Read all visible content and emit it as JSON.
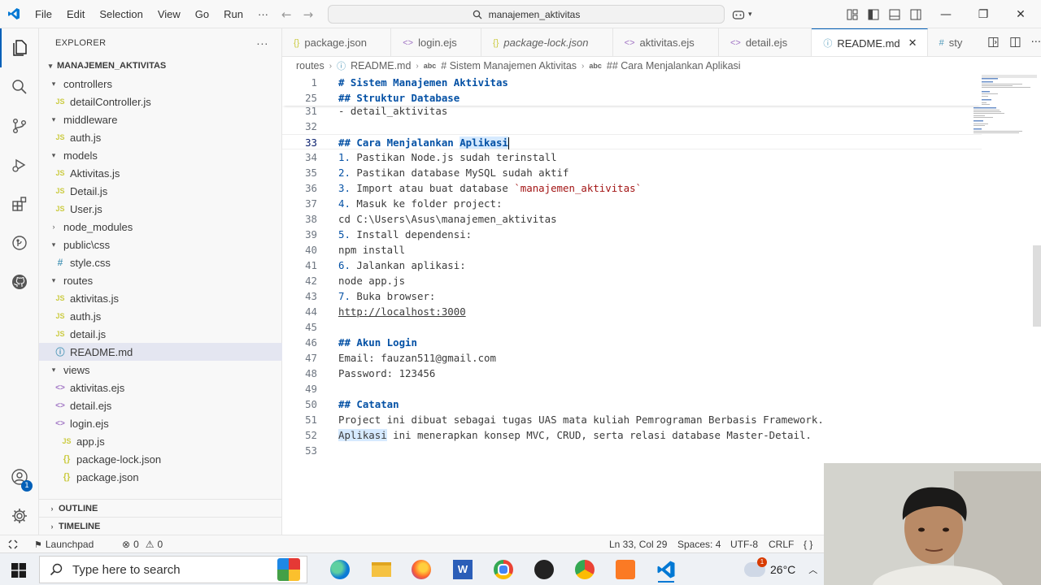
{
  "titlebar": {
    "menu": [
      "File",
      "Edit",
      "Selection",
      "View",
      "Go",
      "Run",
      "···"
    ],
    "search_text": "manajemen_aktivitas"
  },
  "explorer": {
    "header": "EXPLORER",
    "root": "MANAJEMEN_AKTIVITAS",
    "rows": [
      {
        "label": "controllers",
        "kind": "folder",
        "open": true,
        "depth": 1
      },
      {
        "label": "detailController.js",
        "kind": "js",
        "depth": 2
      },
      {
        "label": "middleware",
        "kind": "folder",
        "open": true,
        "depth": 1
      },
      {
        "label": "auth.js",
        "kind": "js",
        "depth": 2
      },
      {
        "label": "models",
        "kind": "folder",
        "open": true,
        "depth": 1
      },
      {
        "label": "Aktivitas.js",
        "kind": "js",
        "depth": 2
      },
      {
        "label": "Detail.js",
        "kind": "js",
        "depth": 2
      },
      {
        "label": "User.js",
        "kind": "js",
        "depth": 2
      },
      {
        "label": "node_modules",
        "kind": "folder",
        "open": false,
        "depth": 1
      },
      {
        "label": "public\\css",
        "kind": "folder",
        "open": true,
        "depth": 1
      },
      {
        "label": "style.css",
        "kind": "css",
        "depth": 2
      },
      {
        "label": "routes",
        "kind": "folder",
        "open": true,
        "depth": 1
      },
      {
        "label": "aktivitas.js",
        "kind": "js",
        "depth": 2
      },
      {
        "label": "auth.js",
        "kind": "js",
        "depth": 2
      },
      {
        "label": "detail.js",
        "kind": "js",
        "depth": 2
      },
      {
        "label": "README.md",
        "kind": "md",
        "depth": 2,
        "selected": true
      },
      {
        "label": "views",
        "kind": "folder",
        "open": true,
        "depth": 1
      },
      {
        "label": "aktivitas.ejs",
        "kind": "ejs",
        "depth": 2
      },
      {
        "label": "detail.ejs",
        "kind": "ejs",
        "depth": 2
      },
      {
        "label": "login.ejs",
        "kind": "ejs",
        "depth": 2
      },
      {
        "label": "app.js",
        "kind": "js",
        "depth": 1
      },
      {
        "label": "package-lock.json",
        "kind": "json",
        "depth": 1
      },
      {
        "label": "package.json",
        "kind": "json",
        "depth": 1
      }
    ],
    "outline": "OUTLINE",
    "timeline": "TIMELINE"
  },
  "tabs": [
    {
      "label": "package.json",
      "icon": "{}"
    },
    {
      "label": "login.ejs",
      "icon": "<>"
    },
    {
      "label": "package-lock.json",
      "icon": "{}",
      "italic": true
    },
    {
      "label": "aktivitas.ejs",
      "icon": "<>"
    },
    {
      "label": "detail.ejs",
      "icon": "<>"
    },
    {
      "label": "README.md",
      "icon": "ⓘ",
      "active": true
    },
    {
      "label": "sty",
      "icon": "#"
    }
  ],
  "breadcrumb": [
    "routes",
    "README.md",
    "# Sistem Manajemen Aktivitas",
    "## Cara Menjalankan Aplikasi"
  ],
  "editor": {
    "sticky": [
      {
        "n": "1",
        "text": "# Sistem Manajemen Aktivitas"
      },
      {
        "n": "25",
        "text": "## Struktur Database"
      }
    ],
    "lines": [
      {
        "n": "31",
        "text": "- detail_aktivitas"
      },
      {
        "n": "32",
        "text": ""
      },
      {
        "n": "33",
        "pre": "## Cara Menjalankan ",
        "hl": "Aplikasi",
        "heading": true,
        "current": true
      },
      {
        "n": "34",
        "num": "1.",
        "text": " Pastikan Node.js sudah terinstall"
      },
      {
        "n": "35",
        "num": "2.",
        "text": " Pastikan database MySQL sudah aktif"
      },
      {
        "n": "36",
        "num": "3.",
        "text": " Import atau buat database ",
        "code": "`manajemen_aktivitas`"
      },
      {
        "n": "37",
        "num": "4.",
        "text": " Masuk ke folder project:"
      },
      {
        "n": "38",
        "text": "cd C:\\Users\\Asus\\manajemen_aktivitas"
      },
      {
        "n": "39",
        "num": "5.",
        "text": " Install dependensi:"
      },
      {
        "n": "40",
        "text": "npm install"
      },
      {
        "n": "41",
        "num": "6.",
        "text": " Jalankan aplikasi:"
      },
      {
        "n": "42",
        "text": "node app.js"
      },
      {
        "n": "43",
        "num": "7.",
        "text": " Buka browser:"
      },
      {
        "n": "44",
        "link": "http://localhost:3000"
      },
      {
        "n": "45",
        "text": ""
      },
      {
        "n": "46",
        "text": "## Akun Login",
        "heading": true
      },
      {
        "n": "47",
        "text": "Email: fauzan511@gmail.com"
      },
      {
        "n": "48",
        "text": "Password: 123456"
      },
      {
        "n": "49",
        "text": ""
      },
      {
        "n": "50",
        "text": "## Catatan",
        "heading": true
      },
      {
        "n": "51",
        "text": "Project ini dibuat sebagai tugas UAS mata kuliah Pemrograman Berbasis Framework."
      },
      {
        "n": "52",
        "hl": "Aplikasi",
        "text": " ini menerapkan konsep MVC, CRUD, serta relasi database Master-Detail."
      },
      {
        "n": "53",
        "text": ""
      }
    ]
  },
  "statusbar": {
    "launchpad": "Launchpad",
    "errors": "0",
    "warnings": "0",
    "position": "Ln 33, Col 29",
    "spaces": "Spaces: 4",
    "encoding": "UTF-8",
    "eol": "CRLF",
    "lang": "{ }"
  },
  "activity": {
    "badge": "1"
  },
  "taskbar": {
    "search_placeholder": "Type here to search",
    "weather": "26°C",
    "weather_badge": "1"
  },
  "colors": {
    "accent": "#005fb8",
    "heading": "#0451a5",
    "code": "#a31515"
  }
}
